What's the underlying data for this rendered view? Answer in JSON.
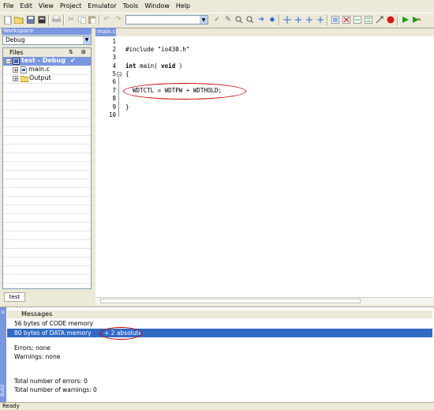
{
  "menu": [
    "File",
    "Edit",
    "View",
    "Project",
    "Emulator",
    "Tools",
    "Window",
    "Help"
  ],
  "toolbar": {
    "icons": [
      "new-file-icon",
      "open-icon",
      "save-icon",
      "save-all-icon",
      "print-icon",
      "cut-icon",
      "copy-icon",
      "paste-icon",
      "undo-icon",
      "redo-icon",
      "find-icon",
      "find-next-icon",
      "bookmark-icon",
      "goto-icon",
      "next-bookmark-icon",
      "prev-bookmark-icon",
      "toggle-bookmark-icon",
      "compile-icon",
      "make-icon",
      "stop-build-icon",
      "debug-icon",
      "download-debug-icon"
    ],
    "combo_value": ""
  },
  "workspace": {
    "title": "Workspace",
    "config": "Debug",
    "files_header": "Files",
    "tree": [
      {
        "label": "test - Debug",
        "expander": "−"
      },
      {
        "label": "main.c",
        "expander": "+"
      },
      {
        "label": "Output",
        "expander": "+"
      }
    ],
    "tab": "test"
  },
  "editor": {
    "tab": "main.c",
    "line_numbers": [
      "1",
      "2",
      "3",
      "4",
      "5",
      "6",
      "7",
      "8",
      "9",
      "10"
    ],
    "lines": [
      "",
      "#include \"io430.h\"",
      "",
      "int main( void )",
      "{",
      "",
      "  WDTCTL = WDTPW + WDTHOLD;",
      "",
      "}",
      ""
    ]
  },
  "messages": {
    "header": "Messages",
    "items": [
      "56 bytes of CODE memory",
      "80 bytes of DATA memory",
      "Errors: none",
      "Warnings: none",
      "Total number of errors: 0",
      "Total number of warnings: 0"
    ],
    "selected_suffix": "+ 2 absolute",
    "side_label": "Build"
  },
  "status": "Ready"
}
